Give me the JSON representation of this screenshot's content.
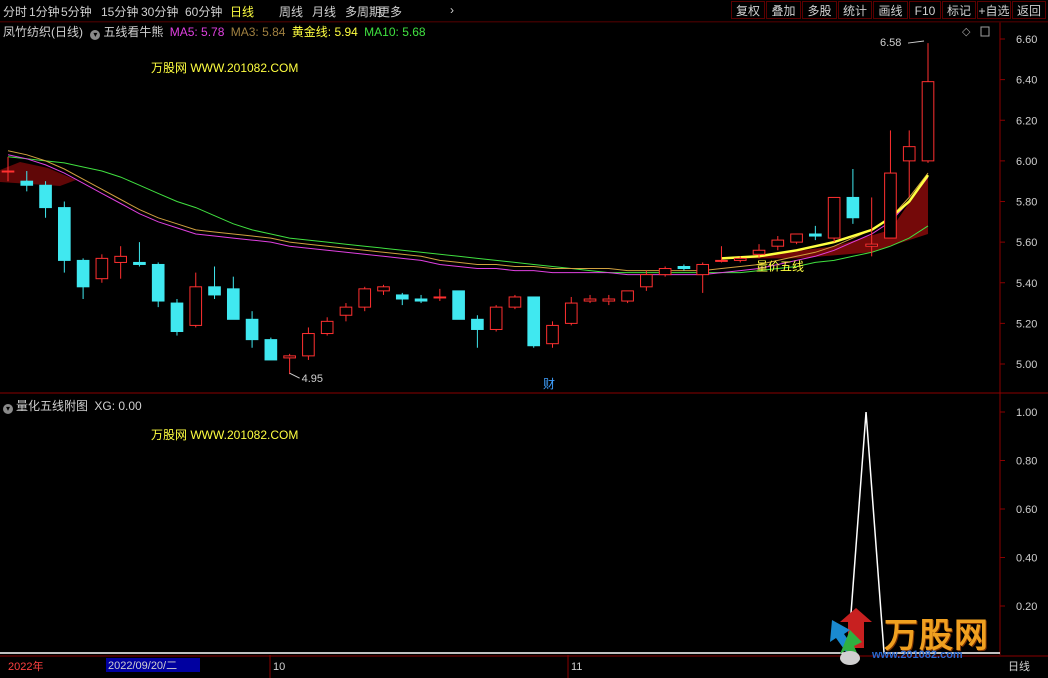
{
  "toolbar": {
    "periods": [
      "分时",
      "1分钟",
      "5分钟",
      "15分钟",
      "30分钟",
      "60分钟",
      "日线",
      "周线",
      "月线",
      "多周期",
      "更多"
    ],
    "active_period": "日线",
    "buttons": [
      "复权",
      "叠加",
      "多股",
      "统计",
      "画线",
      "F10",
      "标记",
      "+自选",
      "返回"
    ]
  },
  "main_panel": {
    "stock_name": "凤竹纺织(日线)",
    "indicator_name": "五线看牛熊",
    "ma5_label": "MA5: 5.78",
    "ma3_label": "MA3: 5.84",
    "gold_label": "黄金线: 5.94",
    "ma10_label": "MA10: 5.68",
    "watermark": "万股网 WWW.201082.COM",
    "high_label": "6.58",
    "low_label": "4.95",
    "annotation": "量价五线",
    "fin_marker": "财",
    "colors": {
      "ma5": "#e040e0",
      "ma3": "#d0a040",
      "gold": "#ffff40",
      "ma10": "#40e040",
      "up": "#ff3030",
      "down": "#40e8f0",
      "band": "#8a0a0a"
    }
  },
  "sub_panel": {
    "indicator_name": "量化五线附图",
    "xg_label": "XG: 0.00",
    "watermark": "万股网 WWW.201082.COM"
  },
  "price_axis": [
    "6.60",
    "6.40",
    "6.20",
    "6.00",
    "5.80",
    "5.60",
    "5.40",
    "5.20",
    "5.00"
  ],
  "sub_axis": [
    "1.00",
    "0.80",
    "0.60",
    "0.40",
    "0.20"
  ],
  "time_axis": {
    "year": "2022年",
    "cursor_date": "2022/09/20/二",
    "months": [
      "10",
      "11"
    ],
    "period": "日线"
  },
  "logo": {
    "text": "万股网",
    "url": "www.201082.com"
  },
  "chart_data": {
    "type": "candlestick",
    "ylim": [
      4.9,
      6.66
    ],
    "candles": [
      {
        "o": 5.95,
        "h": 6.02,
        "l": 5.9,
        "c": 5.95
      },
      {
        "o": 5.9,
        "h": 5.95,
        "l": 5.85,
        "c": 5.88
      },
      {
        "o": 5.88,
        "h": 5.9,
        "l": 5.72,
        "c": 5.77
      },
      {
        "o": 5.77,
        "h": 5.8,
        "l": 5.45,
        "c": 5.51
      },
      {
        "o": 5.51,
        "h": 5.52,
        "l": 5.32,
        "c": 5.38
      },
      {
        "o": 5.42,
        "h": 5.54,
        "l": 5.4,
        "c": 5.52
      },
      {
        "o": 5.5,
        "h": 5.58,
        "l": 5.42,
        "c": 5.53
      },
      {
        "o": 5.5,
        "h": 5.6,
        "l": 5.48,
        "c": 5.49
      },
      {
        "o": 5.49,
        "h": 5.5,
        "l": 5.28,
        "c": 5.31
      },
      {
        "o": 5.3,
        "h": 5.32,
        "l": 5.14,
        "c": 5.16
      },
      {
        "o": 5.19,
        "h": 5.45,
        "l": 5.18,
        "c": 5.38
      },
      {
        "o": 5.38,
        "h": 5.48,
        "l": 5.32,
        "c": 5.34
      },
      {
        "o": 5.37,
        "h": 5.43,
        "l": 5.22,
        "c": 5.22
      },
      {
        "o": 5.22,
        "h": 5.26,
        "l": 5.08,
        "c": 5.12
      },
      {
        "o": 5.12,
        "h": 5.13,
        "l": 5.02,
        "c": 5.02
      },
      {
        "o": 5.03,
        "h": 5.05,
        "l": 4.95,
        "c": 5.04
      },
      {
        "o": 5.04,
        "h": 5.18,
        "l": 5.02,
        "c": 5.15
      },
      {
        "o": 5.15,
        "h": 5.23,
        "l": 5.14,
        "c": 5.21
      },
      {
        "o": 5.24,
        "h": 5.3,
        "l": 5.21,
        "c": 5.28
      },
      {
        "o": 5.28,
        "h": 5.38,
        "l": 5.26,
        "c": 5.37
      },
      {
        "o": 5.36,
        "h": 5.39,
        "l": 5.34,
        "c": 5.38
      },
      {
        "o": 5.34,
        "h": 5.35,
        "l": 5.29,
        "c": 5.32
      },
      {
        "o": 5.32,
        "h": 5.34,
        "l": 5.3,
        "c": 5.31
      },
      {
        "o": 5.33,
        "h": 5.37,
        "l": 5.31,
        "c": 5.33
      },
      {
        "o": 5.36,
        "h": 5.36,
        "l": 5.22,
        "c": 5.22
      },
      {
        "o": 5.22,
        "h": 5.24,
        "l": 5.08,
        "c": 5.17
      },
      {
        "o": 5.17,
        "h": 5.29,
        "l": 5.16,
        "c": 5.28
      },
      {
        "o": 5.28,
        "h": 5.34,
        "l": 5.27,
        "c": 5.33
      },
      {
        "o": 5.33,
        "h": 5.33,
        "l": 5.08,
        "c": 5.09
      },
      {
        "o": 5.1,
        "h": 5.21,
        "l": 5.08,
        "c": 5.19
      },
      {
        "o": 5.2,
        "h": 5.33,
        "l": 5.19,
        "c": 5.3
      },
      {
        "o": 5.31,
        "h": 5.34,
        "l": 5.3,
        "c": 5.32
      },
      {
        "o": 5.31,
        "h": 5.34,
        "l": 5.29,
        "c": 5.32
      },
      {
        "o": 5.31,
        "h": 5.36,
        "l": 5.3,
        "c": 5.36
      },
      {
        "o": 5.38,
        "h": 5.46,
        "l": 5.36,
        "c": 5.44
      },
      {
        "o": 5.44,
        "h": 5.48,
        "l": 5.43,
        "c": 5.47
      },
      {
        "o": 5.48,
        "h": 5.49,
        "l": 5.46,
        "c": 5.47
      },
      {
        "o": 5.44,
        "h": 5.5,
        "l": 5.35,
        "c": 5.49
      },
      {
        "o": 5.51,
        "h": 5.58,
        "l": 5.5,
        "c": 5.51
      },
      {
        "o": 5.51,
        "h": 5.53,
        "l": 5.5,
        "c": 5.52
      },
      {
        "o": 5.54,
        "h": 5.59,
        "l": 5.52,
        "c": 5.56
      },
      {
        "o": 5.58,
        "h": 5.63,
        "l": 5.56,
        "c": 5.61
      },
      {
        "o": 5.6,
        "h": 5.64,
        "l": 5.59,
        "c": 5.64
      },
      {
        "o": 5.64,
        "h": 5.68,
        "l": 5.61,
        "c": 5.63
      },
      {
        "o": 5.62,
        "h": 5.82,
        "l": 5.6,
        "c": 5.82
      },
      {
        "o": 5.82,
        "h": 5.96,
        "l": 5.69,
        "c": 5.72
      },
      {
        "o": 5.58,
        "h": 5.82,
        "l": 5.53,
        "c": 5.59
      },
      {
        "o": 5.62,
        "h": 6.15,
        "l": 5.62,
        "c": 5.94
      },
      {
        "o": 6.0,
        "h": 6.15,
        "l": 5.82,
        "c": 6.07
      },
      {
        "o": 6.0,
        "h": 6.58,
        "l": 5.99,
        "c": 6.39
      }
    ],
    "ma_lines": {
      "ma5": [
        6.03,
        6.01,
        5.98,
        5.94,
        5.89,
        5.84,
        5.79,
        5.74,
        5.7,
        5.67,
        5.64,
        5.63,
        5.62,
        5.61,
        5.6,
        5.58,
        5.57,
        5.56,
        5.55,
        5.54,
        5.53,
        5.52,
        5.51,
        5.49,
        5.48,
        5.47,
        5.47,
        5.46,
        5.46,
        5.45,
        5.45,
        5.45,
        5.45,
        5.44,
        5.44,
        5.44,
        5.44,
        5.44,
        5.45,
        5.46,
        5.47,
        5.49,
        5.51,
        5.53,
        5.56,
        5.6,
        5.64,
        5.7,
        5.8,
        5.92
      ],
      "ma10": [
        6.02,
        6.01,
        6.0,
        5.99,
        5.97,
        5.95,
        5.92,
        5.88,
        5.84,
        5.8,
        5.77,
        5.73,
        5.69,
        5.66,
        5.64,
        5.62,
        5.61,
        5.6,
        5.59,
        5.58,
        5.57,
        5.56,
        5.55,
        5.54,
        5.53,
        5.52,
        5.51,
        5.5,
        5.49,
        5.48,
        5.47,
        5.46,
        5.45,
        5.45,
        5.45,
        5.45,
        5.45,
        5.45,
        5.45,
        5.45,
        5.46,
        5.47,
        5.48,
        5.5,
        5.51,
        5.53,
        5.55,
        5.58,
        5.62,
        5.68
      ]
    },
    "sub_series": {
      "name": "XG",
      "ylim": [
        0,
        1.05
      ],
      "spike_index": 46,
      "spike_value": 1.0
    }
  }
}
